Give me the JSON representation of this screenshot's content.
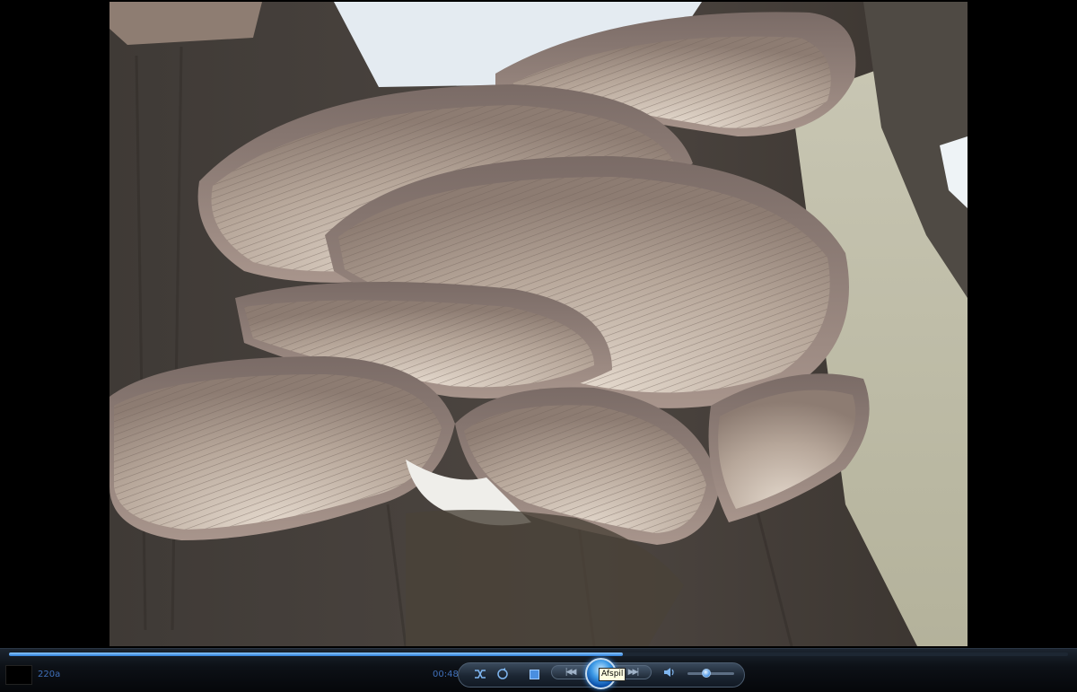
{
  "video": {
    "content": "oyster mushrooms growing on a tree trunk with snow"
  },
  "player": {
    "status_text": "220a",
    "elapsed_time": "00:48",
    "seek_progress": 0.58,
    "volume_level": 0.4,
    "tooltip": "Afspil"
  },
  "icons": {
    "shuffle": "shuffle-icon",
    "repeat": "repeat-icon",
    "stop": "stop-icon",
    "previous": "previous-icon",
    "play": "play-icon",
    "next": "next-icon",
    "volume": "volume-icon"
  },
  "colors": {
    "accent": "#3d9ae6",
    "status_text": "#3f6fb8",
    "tooltip_bg": "#ffffe1"
  }
}
